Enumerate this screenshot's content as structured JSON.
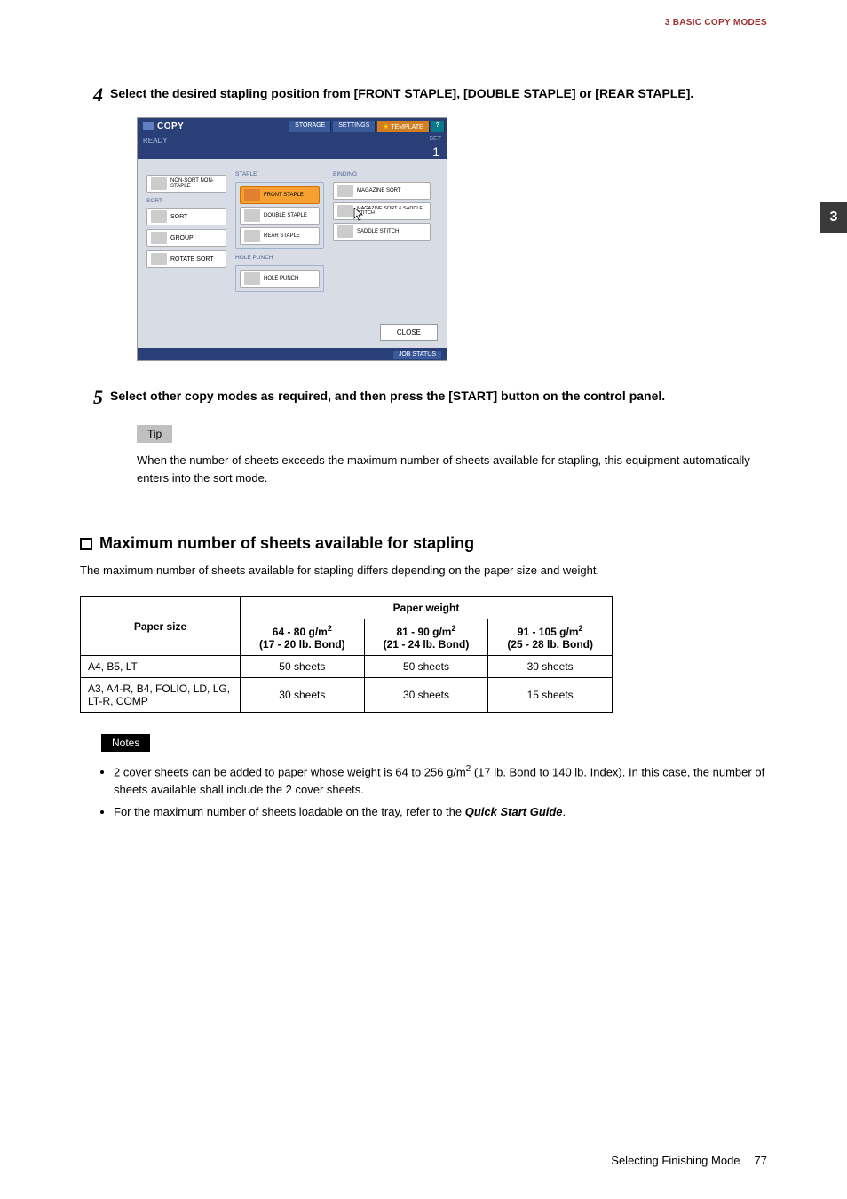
{
  "header": {
    "chapter": "3 BASIC COPY MODES"
  },
  "side_tab": "3",
  "steps": {
    "s4": {
      "num": "4",
      "text": "Select the desired stapling position from [FRONT STAPLE], [DOUBLE STAPLE] or [REAR STAPLE]."
    },
    "s5": {
      "num": "5",
      "text": "Select other copy modes as required, and then press the [START] button on the control panel."
    }
  },
  "screenshot": {
    "title": "COPY",
    "top_buttons": {
      "storage": "STORAGE",
      "settings": "SETTINGS",
      "template": "TEMPLATE",
      "help": "?"
    },
    "ready": "READY",
    "set": "SET",
    "one": "1",
    "left_col": {
      "nonsort": "NON-SORT NON-STAPLE",
      "sort_header": "SORT",
      "sort": "SORT",
      "group": "GROUP",
      "rotate": "ROTATE SORT"
    },
    "staple_group": {
      "label": "STAPLE",
      "front": "FRONT STAPLE",
      "double": "DOUBLE STAPLE",
      "rear": "REAR STAPLE"
    },
    "punch_group": {
      "label": "HOLE PUNCH",
      "punch": "HOLE PUNCH"
    },
    "binding_group": {
      "label": "BINDING",
      "mag": "MAGAZINE SORT",
      "magstitch": "MAGAZINE SORT & SADDLE STITCH",
      "saddle": "SADDLE STITCH"
    },
    "close": "CLOSE",
    "jobstatus": "JOB STATUS"
  },
  "tip": {
    "label": "Tip",
    "text": "When the number of sheets exceeds the maximum number of sheets available for stapling, this equipment automatically enters into the sort mode."
  },
  "section": {
    "title": "Maximum number of sheets available for stapling",
    "intro": "The maximum number of sheets available for stapling differs depending on the paper size and weight."
  },
  "table": {
    "paper_size_h": "Paper size",
    "paper_weight_h": "Paper weight",
    "w1a": "64 - 80 g/m",
    "w1b": "(17 - 20 lb. Bond)",
    "w2a": "81 - 90 g/m",
    "w2b": "(21 - 24 lb. Bond)",
    "w3a": "91 - 105 g/m",
    "w3b": "(25 - 28 lb. Bond)",
    "r1c0": "A4, B5, LT",
    "r1c1": "50 sheets",
    "r1c2": "50 sheets",
    "r1c3": "30 sheets",
    "r2c0": "A3, A4-R, B4, FOLIO, LD, LG, LT-R, COMP",
    "r2c1": "30 sheets",
    "r2c2": "30 sheets",
    "r2c3": "15 sheets"
  },
  "notes": {
    "label": "Notes",
    "n1a": "2 cover sheets can be added to paper whose weight is 64 to 256 g/m",
    "n1b": " (17 lb. Bond to 140 lb. Index). In this case, the number of sheets available shall include the 2 cover sheets.",
    "n2a": "For the maximum number of sheets loadable on the tray, refer to the ",
    "n2b": "Quick Start Guide",
    "n2c": "."
  },
  "footer": {
    "title": "Selecting Finishing Mode",
    "page": "77"
  }
}
